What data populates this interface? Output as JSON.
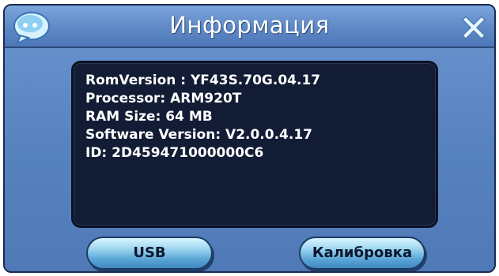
{
  "window": {
    "title": "Информация"
  },
  "info": {
    "lines": [
      "RomVersion : YF43S.70G.04.17",
      "Processor: ARM920T",
      "RAM Size: 64 MB",
      "Software Version: V2.0.0.4.17",
      "ID: 2D459471000000C6"
    ]
  },
  "buttons": {
    "usb_label": "USB",
    "calibration_label": "Калибровка"
  },
  "icons": {
    "top_left": "chat-bubble-icon",
    "top_right": "close-icon"
  },
  "colors": {
    "window_bg": "#5782c0",
    "panel_bg": "#121c34",
    "button_light": "#9fd7f0",
    "button_dark": "#3f88c2",
    "text": "#ffffff"
  }
}
